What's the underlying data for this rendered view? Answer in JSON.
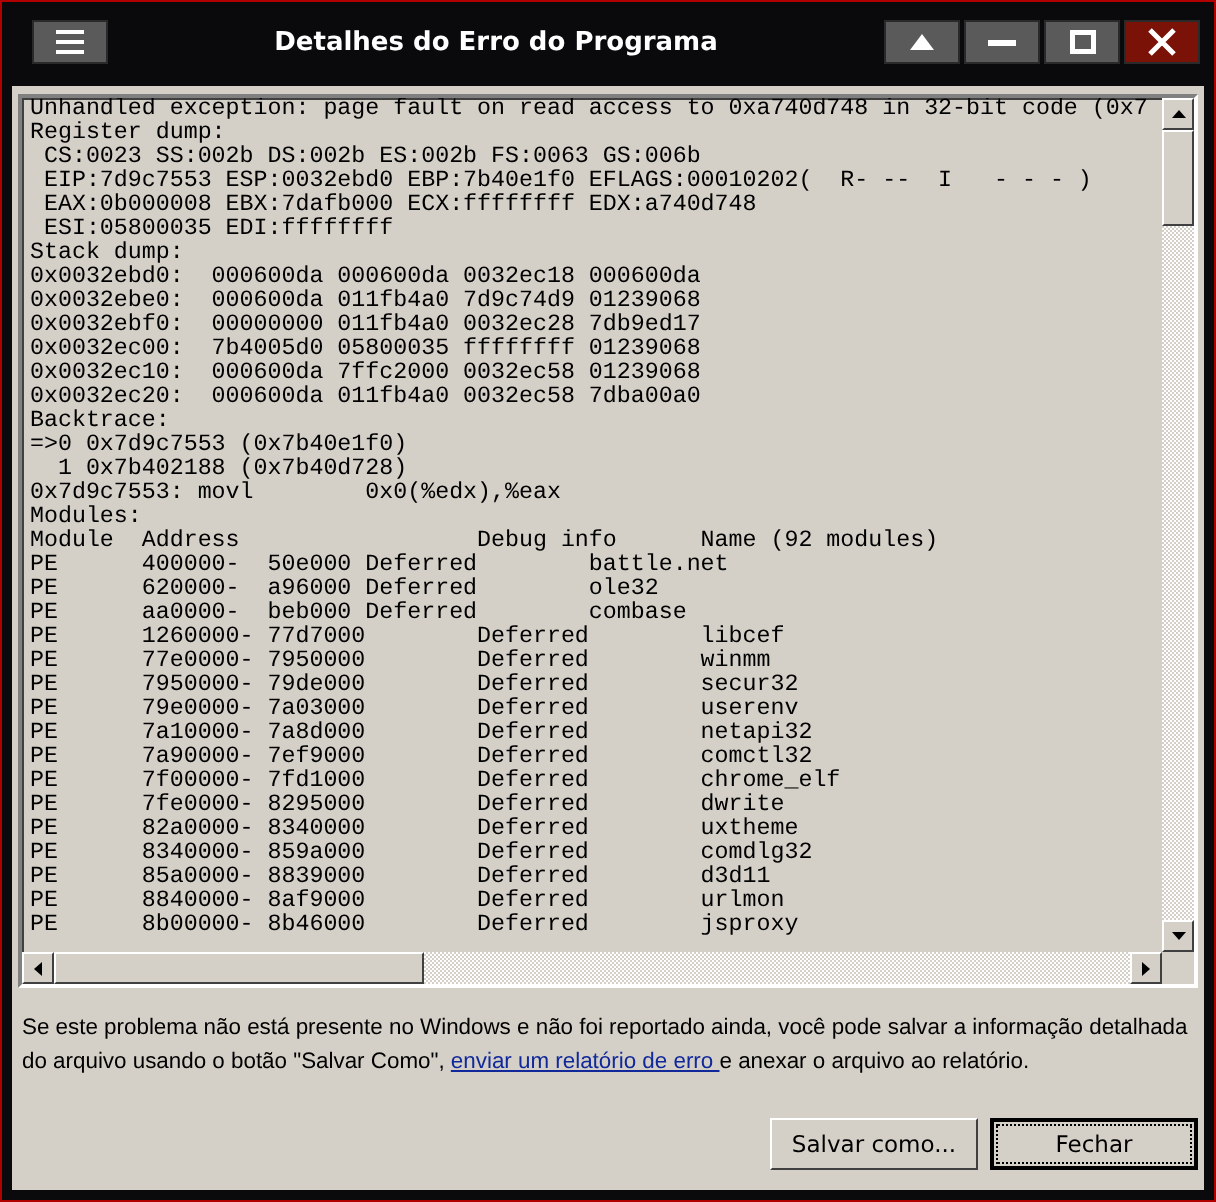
{
  "window": {
    "title": "Detalhes do Erro do Programa"
  },
  "log_lines": [
    "Unhandled exception: page fault on read access to 0xa740d748 in 32-bit code (0x7",
    "Register dump:",
    " CS:0023 SS:002b DS:002b ES:002b FS:0063 GS:006b",
    " EIP:7d9c7553 ESP:0032ebd0 EBP:7b40e1f0 EFLAGS:00010202(  R- --  I   - - - )",
    " EAX:0b000008 EBX:7dafb000 ECX:ffffffff EDX:a740d748",
    " ESI:05800035 EDI:ffffffff",
    "Stack dump:",
    "0x0032ebd0:  000600da 000600da 0032ec18 000600da",
    "0x0032ebe0:  000600da 011fb4a0 7d9c74d9 01239068",
    "0x0032ebf0:  00000000 011fb4a0 0032ec28 7db9ed17",
    "0x0032ec00:  7b4005d0 05800035 ffffffff 01239068",
    "0x0032ec10:  000600da 7ffc2000 0032ec58 01239068",
    "0x0032ec20:  000600da 011fb4a0 0032ec58 7dba00a0",
    "Backtrace:",
    "=>0 0x7d9c7553 (0x7b40e1f0)",
    "  1 0x7b402188 (0x7b40d728)",
    "0x7d9c7553: movl        0x0(%edx),%eax",
    "Modules:",
    "Module  Address                 Debug info      Name (92 modules)",
    "PE      400000-  50e000 Deferred        battle.net",
    "PE      620000-  a96000 Deferred        ole32",
    "PE      aa0000-  beb000 Deferred        combase",
    "PE      1260000- 77d7000        Deferred        libcef",
    "PE      77e0000- 7950000        Deferred        winmm",
    "PE      7950000- 79de000        Deferred        secur32",
    "PE      79e0000- 7a03000        Deferred        userenv",
    "PE      7a10000- 7a8d000        Deferred        netapi32",
    "PE      7a90000- 7ef9000        Deferred        comctl32",
    "PE      7f00000- 7fd1000        Deferred        chrome_elf",
    "PE      7fe0000- 8295000        Deferred        dwrite",
    "PE      82a0000- 8340000        Deferred        uxtheme",
    "PE      8340000- 859a000        Deferred        comdlg32",
    "PE      85a0000- 8839000        Deferred        d3d11",
    "PE      8840000- 8af9000        Deferred        urlmon",
    "PE      8b00000- 8b46000        Deferred        jsproxy"
  ],
  "message": {
    "before": "Se este problema não está presente no Windows e não foi reportado ainda, você pode salvar a informação detalhada do arquivo usando o botão \"Salvar Como\", ",
    "link": "enviar um relatório de erro ",
    "after": " e anexar o arquivo ao relatório."
  },
  "buttons": [
    {
      "label": "Salvar como...",
      "default": false
    },
    {
      "label": "Fechar",
      "default": true
    }
  ]
}
